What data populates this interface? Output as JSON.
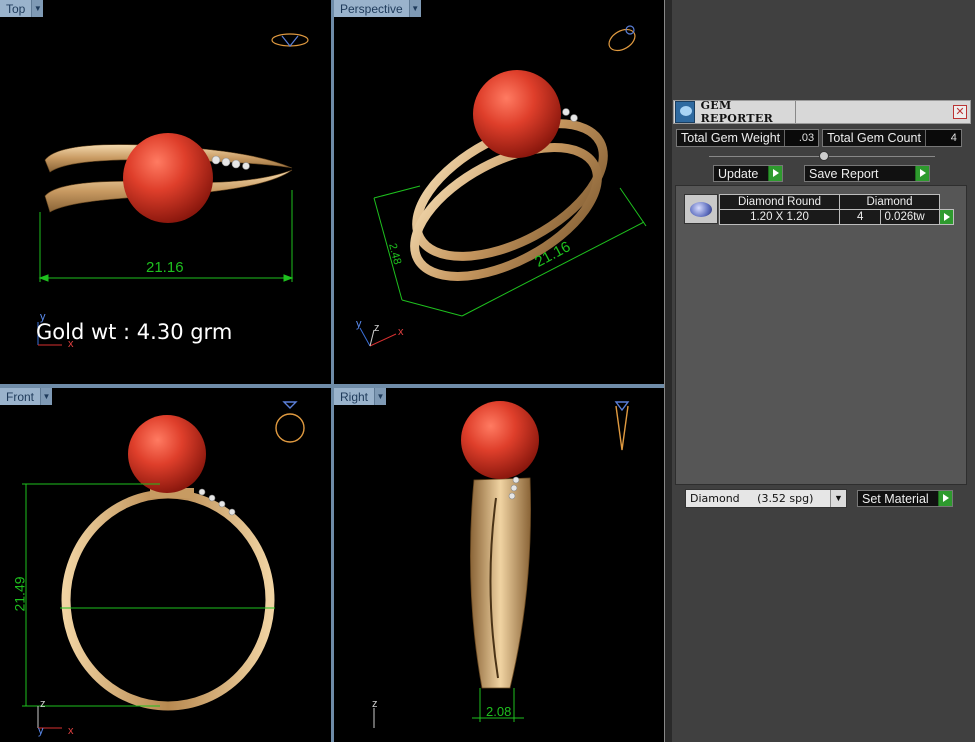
{
  "viewports": {
    "top": {
      "label": "Top",
      "width_dim": "21.16",
      "axis_y": "y",
      "axis_x": "x"
    },
    "perspective": {
      "label": "Perspective",
      "width_dim": "21.16",
      "height_dim": "2.48",
      "axis_y": "y",
      "axis_z": "z",
      "axis_x": "x"
    },
    "front": {
      "label": "Front",
      "height_dim": "21.49",
      "axis_z": "z",
      "axis_y": "y",
      "axis_x": "x"
    },
    "right": {
      "label": "Right",
      "band_dim": "2.08",
      "axis_z": "z"
    }
  },
  "gold_note": "Gold wt : 4.30 grm",
  "gem_reporter": {
    "title": "GEM REPORTER",
    "close_glyph": "✕",
    "total_weight_label": "Total Gem Weight",
    "total_weight_value": ".03",
    "total_count_label": "Total Gem Count",
    "total_count_value": "4",
    "update_label": "Update",
    "save_report_label": "Save Report",
    "report": {
      "headers": [
        "Diamond Round",
        "Diamond"
      ],
      "rows": [
        {
          "size": "1.20 X 1.20",
          "count": "4",
          "weight": "0.026tw"
        }
      ]
    },
    "material_select": "Diamond     (3.52 spg)",
    "set_material_label": "Set Material"
  },
  "colors": {
    "viewport_bg": "#000000",
    "gold": "#d8b07a",
    "ruby": "#d8412c",
    "dimension_green": "#1ec01e",
    "tab_blue": "#9ab3cc",
    "panel_bg": "#565656",
    "action_green": "#2e9a2e"
  }
}
